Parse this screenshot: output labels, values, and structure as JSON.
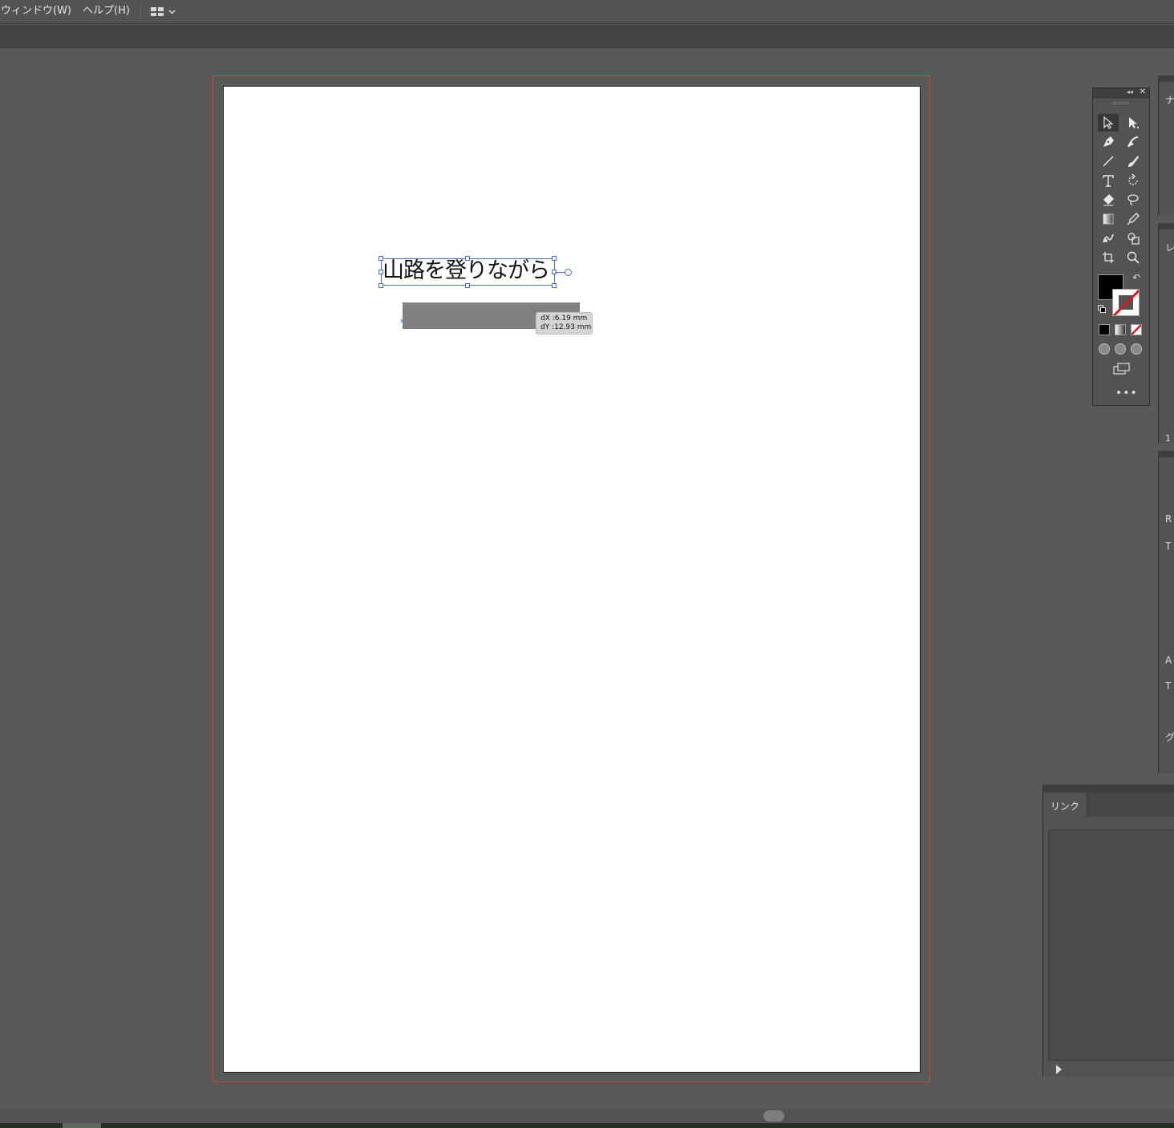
{
  "menubar": {
    "items": [
      "ウィンドウ(W)",
      "ヘルプ(H)"
    ],
    "workspace_icon": "workspace-grid-icon",
    "workspace_arrow": "chevron-down-icon"
  },
  "canvas": {
    "text_object": "山路を登りながら",
    "tooltip": {
      "dx": "dX :6.19 mm",
      "dy": "dY :12.93 mm"
    },
    "colors": {
      "bleed": "#c8453a",
      "selection": "#4a6dd6",
      "rect_fill": "#808080"
    }
  },
  "tools_panel": {
    "collapse_label": "◂◂",
    "close_label": "✕",
    "tools": [
      "selection-tool-icon",
      "direct-selection-tool-icon",
      "pen-tool-icon",
      "curvature-tool-icon",
      "line-tool-icon",
      "paintbrush-tool-icon",
      "type-tool-icon",
      "rotate-tool-icon",
      "eraser-tool-icon",
      "lasso-tool-icon",
      "gradient-tool-icon",
      "eyedropper-tool-icon",
      "puppet-warp-tool-icon",
      "shape-builder-tool-icon",
      "artboard-tool-icon",
      "zoom-tool-icon"
    ],
    "more_label": "•••",
    "fill_color": "#000000",
    "stroke_color": "none"
  },
  "dock": {
    "panel1_glyph": "ナ",
    "panel2_glyph": "レ",
    "panel2_number": "1",
    "panel3_glyphs": [
      "R",
      "T",
      "A",
      "T",
      "グ"
    ]
  },
  "links_panel": {
    "tab_label": "リンク"
  }
}
